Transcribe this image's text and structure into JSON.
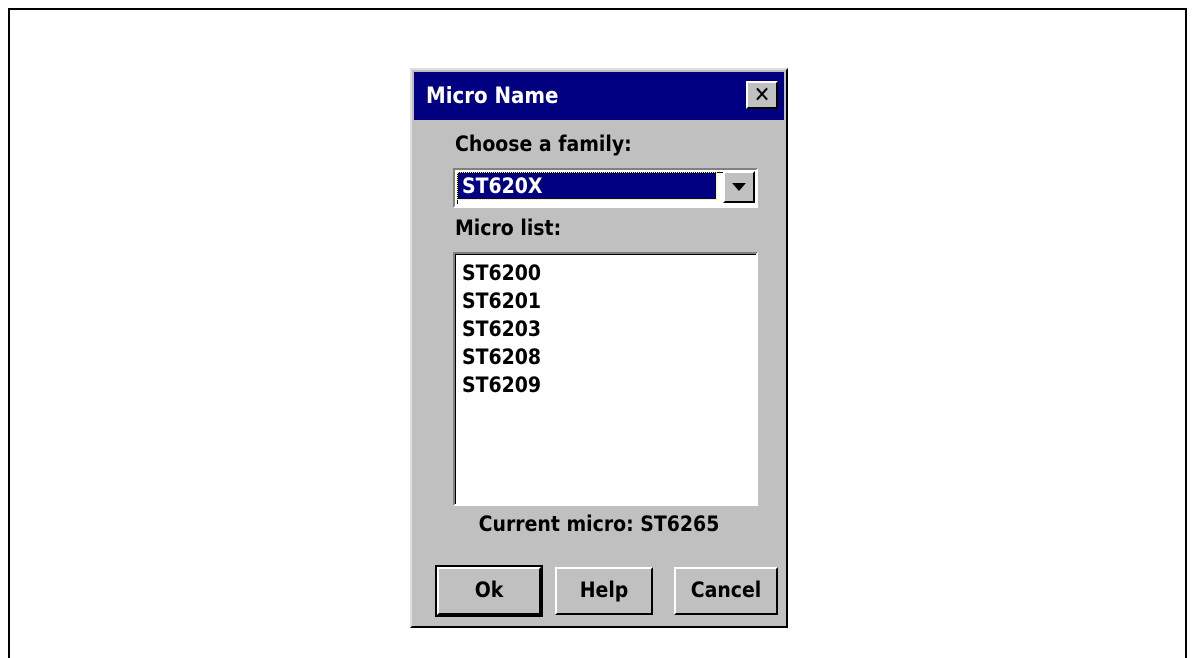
{
  "dialog": {
    "title": "Micro Name",
    "close_glyph": "✕",
    "family_label": "Choose a family:",
    "family_selected": "ST620X",
    "micro_list_label": "Micro list:",
    "micro_list": [
      "ST6200",
      "ST6201",
      "ST6203",
      "ST6208",
      "ST6209"
    ],
    "current_micro": "Current micro: ST6265",
    "buttons": {
      "ok": "Ok",
      "help": "Help",
      "cancel": "Cancel"
    }
  },
  "icons": {
    "close": "close-icon",
    "dropdown": "chevron-down-icon"
  },
  "colors": {
    "titlebar": "#000080",
    "face": "#c0c0c0",
    "selection": "#000080"
  }
}
